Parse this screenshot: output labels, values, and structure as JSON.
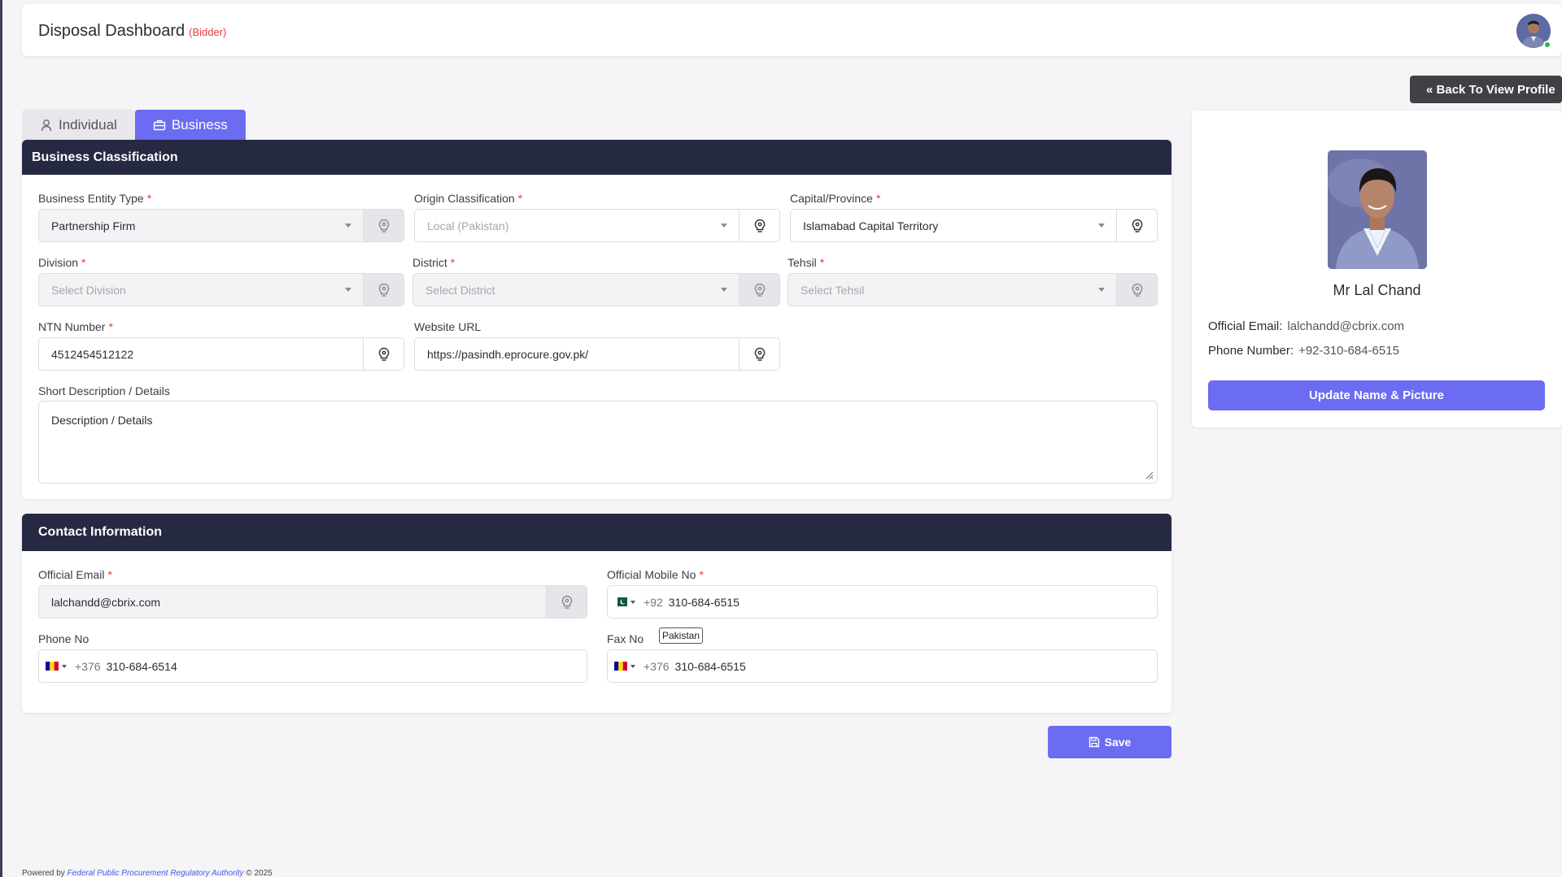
{
  "header": {
    "title": "Disposal Dashboard",
    "role": "(Bidder)"
  },
  "back_button": "Back To View Profile",
  "tabs": [
    {
      "label": "Individual",
      "icon": "user-icon",
      "active": false
    },
    {
      "label": "Business",
      "icon": "briefcase-icon",
      "active": true
    }
  ],
  "business": {
    "title": "Business Classification",
    "entity_type": {
      "label": "Business Entity Type",
      "value": "Partnership Firm"
    },
    "origin": {
      "label": "Origin Classification",
      "placeholder": "Local (Pakistan)"
    },
    "province": {
      "label": "Capital/Province",
      "value": "Islamabad Capital Territory"
    },
    "division": {
      "label": "Division",
      "placeholder": "Select Division"
    },
    "district": {
      "label": "District",
      "placeholder": "Select District"
    },
    "tehsil": {
      "label": "Tehsil",
      "placeholder": "Select Tehsil"
    },
    "ntn": {
      "label": "NTN Number",
      "value": "4512454512122"
    },
    "website": {
      "label": "Website URL",
      "value": "https://pasindh.eprocure.gov.pk/"
    },
    "description": {
      "label": "Short Description / Details",
      "value": "Description / Details"
    },
    "required_mark": "*"
  },
  "contact": {
    "title": "Contact Information",
    "email": {
      "label": "Official Email",
      "value": "lalchandd@cbrix.com"
    },
    "mobile": {
      "label": "Official Mobile No",
      "code": "+92",
      "value": "310-684-6515"
    },
    "phone": {
      "label": "Phone No",
      "code": "+376",
      "value": "310-684-6514"
    },
    "fax": {
      "label": "Fax No",
      "code": "+376",
      "value": "310-684-6515"
    },
    "tooltip": "Pakistan"
  },
  "save_button": "Save",
  "profile": {
    "name": "Mr Lal Chand",
    "email_label": "Official Email:",
    "email": "lalchandd@cbrix.com",
    "phone_label": "Phone Number:",
    "phone": "+92-310-684-6515",
    "update_button": "Update Name & Picture"
  },
  "footer": {
    "prefix": "Powered by",
    "org": "Federal Public Procurement Regulatory Authority",
    "suffix": "© 2025"
  },
  "colors": {
    "accent": "#6b6cf2",
    "header_dark": "#262942",
    "required": "#e0403a"
  }
}
